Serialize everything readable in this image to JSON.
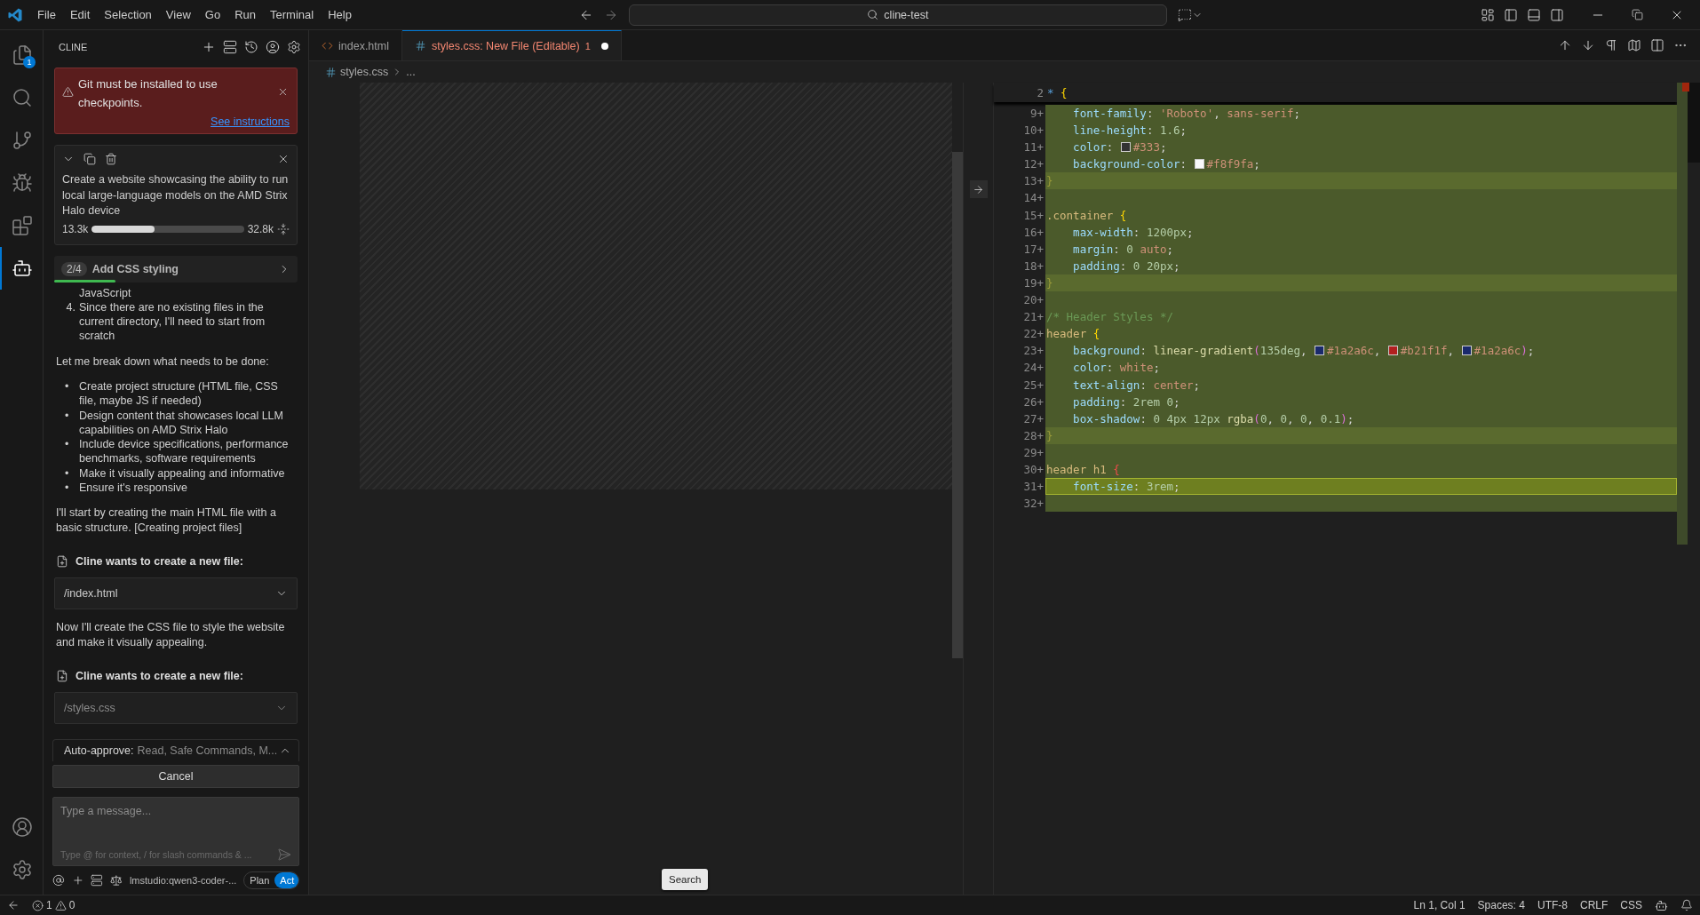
{
  "menu": [
    "File",
    "Edit",
    "Selection",
    "View",
    "Go",
    "Run",
    "Terminal",
    "Help"
  ],
  "command_center": {
    "text": "cline-test"
  },
  "activity_bar": {
    "items": [
      {
        "kind": "explorer",
        "badge": "1",
        "selected": false
      },
      {
        "kind": "search",
        "selected": false
      },
      {
        "kind": "source-control",
        "selected": false
      },
      {
        "kind": "debug",
        "selected": false
      },
      {
        "kind": "extensions",
        "selected": false
      },
      {
        "kind": "cline",
        "selected": true
      }
    ],
    "bottom": [
      {
        "kind": "account"
      },
      {
        "kind": "settings"
      }
    ]
  },
  "sidebar": {
    "title": "CLINE",
    "alert": {
      "text": "Git must be installed to use checkpoints.",
      "link": "See instructions"
    },
    "task": {
      "text": "Create a website showcasing the ability to run local large-language models on the AMD Strix Halo device",
      "tokens_used": "13.3k",
      "level": 0.41,
      "tokens_max": "32.8k"
    },
    "step": {
      "count": "2/4",
      "title": "Add CSS styling",
      "level": 0.25
    },
    "messages": [
      {
        "kind": "continuation",
        "text": "JavaScript"
      },
      {
        "kind": "numbered",
        "number": "4.",
        "text": "Since there are no existing files in the current directory, I'll need to start from scratch"
      },
      {
        "kind": "paragraph",
        "text": "Let me break down what needs to be done:"
      },
      {
        "kind": "bullets",
        "marker": "•",
        "items": [
          "Create project structure (HTML file, CSS file, maybe JS if needed)",
          "Design content that showcases local LLM capabilities on AMD Strix Halo",
          "Include device specifications, performance benchmarks, software requirements",
          "Make it visually appealing and informative",
          "Ensure it's responsive"
        ]
      },
      {
        "kind": "paragraph",
        "text": "I'll start by creating the main HTML file with a basic structure. [Creating project files]"
      },
      {
        "kind": "tool",
        "title": "Cline wants to create a new file:",
        "file": "/index.html",
        "dimmed": false
      },
      {
        "kind": "paragraph",
        "text": "Now I'll create the CSS file to style the website and make it visually appealing."
      },
      {
        "kind": "tool",
        "title": "Cline wants to create a new file:",
        "file": "/styles.css",
        "dimmed": true
      }
    ],
    "auto_approve": {
      "label": "Auto-approve:",
      "value": "Read, Safe Commands, M..."
    },
    "cancel": "Cancel",
    "input": {
      "placeholder": "Type a message...",
      "hint": "Type @ for context, / for slash commands & ..."
    },
    "model": "lmstudio:qwen3-coder-...",
    "modes": [
      {
        "label": "Plan",
        "selected": false
      },
      {
        "label": "Act",
        "selected": true
      }
    ]
  },
  "tabs": [
    {
      "kind": "html",
      "label": "index.html",
      "selected": false
    },
    {
      "kind": "css",
      "label": "styles.css: New File (Editable)",
      "problems": "1",
      "dirty": true,
      "selected": true
    }
  ],
  "breadcrumb": {
    "file": "styles.css",
    "rest": "..."
  },
  "code": {
    "sticky": {
      "number": "2",
      "text": "* {"
    },
    "lines": [
      {
        "number": "9",
        "marker": "+",
        "kind": "added",
        "text": "    font-family: 'Roboto', sans-serif;"
      },
      {
        "number": "10",
        "marker": "+",
        "kind": "added",
        "text": "    line-height: 1.6;"
      },
      {
        "number": "11",
        "marker": "+",
        "kind": "added",
        "text": "    color: #333;"
      },
      {
        "number": "12",
        "marker": "+",
        "kind": "added",
        "text": "    background-color: #f8f9fa;"
      },
      {
        "number": "13",
        "marker": "+",
        "kind": "brace",
        "text": "}"
      },
      {
        "number": "14",
        "marker": "+",
        "kind": "added"
      },
      {
        "number": "15",
        "marker": "+",
        "kind": "added",
        "text": ".container {"
      },
      {
        "number": "16",
        "marker": "+",
        "kind": "added",
        "text": "    max-width: 1200px;"
      },
      {
        "number": "17",
        "marker": "+",
        "kind": "added",
        "text": "    margin: 0 auto;"
      },
      {
        "number": "18",
        "marker": "+",
        "kind": "added",
        "text": "    padding: 0 20px;"
      },
      {
        "number": "19",
        "marker": "+",
        "kind": "brace",
        "text": "}"
      },
      {
        "number": "20",
        "marker": "+",
        "kind": "added"
      },
      {
        "number": "21",
        "marker": "+",
        "kind": "added",
        "text": "/* Header Styles */"
      },
      {
        "number": "22",
        "marker": "+",
        "kind": "added",
        "text": "header {"
      },
      {
        "number": "23",
        "marker": "+",
        "kind": "added",
        "text": "    background: linear-gradient(135deg, #1a2a6c, #b21f1f, #1a2a6c);"
      },
      {
        "number": "24",
        "marker": "+",
        "kind": "added",
        "text": "    color: white;"
      },
      {
        "number": "25",
        "marker": "+",
        "kind": "added",
        "text": "    text-align: center;"
      },
      {
        "number": "26",
        "marker": "+",
        "kind": "added",
        "text": "    padding: 2rem 0;"
      },
      {
        "number": "27",
        "marker": "+",
        "kind": "added",
        "text": "    box-shadow: 0 4px 12px rgba(0, 0, 0, 0.1);"
      },
      {
        "number": "28",
        "marker": "+",
        "kind": "brace",
        "text": "}"
      },
      {
        "number": "29",
        "marker": "+",
        "kind": "added"
      },
      {
        "number": "30",
        "marker": "+",
        "kind": "unmatched",
        "text": "header h1 {"
      },
      {
        "number": "31",
        "marker": "+",
        "kind": "current",
        "text": "    font-size: 3rem;"
      },
      {
        "number": "32",
        "marker": "+",
        "kind": "added"
      }
    ]
  },
  "tooltip": "Search",
  "status_bar": {
    "errors": "1",
    "warnings": "0",
    "right": [
      "Ln 1, Col 1",
      "Spaces: 4",
      "UTF-8",
      "CRLF",
      "CSS"
    ]
  }
}
